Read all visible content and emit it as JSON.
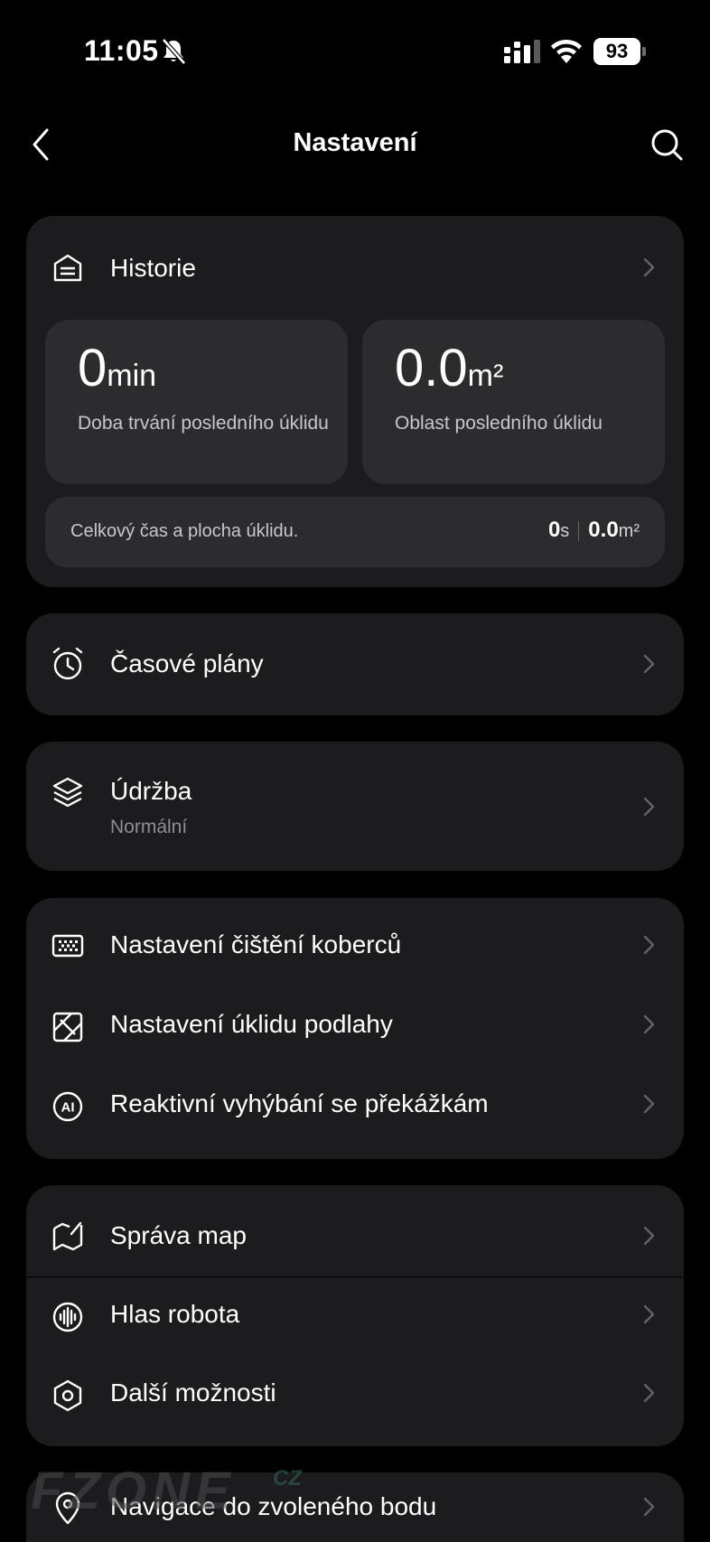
{
  "status": {
    "time": "11:05",
    "battery": "93"
  },
  "header": {
    "title": "Nastavení"
  },
  "history": {
    "label": "Historie",
    "duration_value": "0",
    "duration_unit": "min",
    "duration_label": "Doba trvání posledního úklidu",
    "area_value": "0.0",
    "area_unit": "m²",
    "area_label": "Oblast posledního úklidu",
    "total_label": "Celkový čas a plocha úklidu.",
    "total_time_value": "0",
    "total_time_unit": "s",
    "total_area_value": "0.0",
    "total_area_unit": "m²"
  },
  "schedules": {
    "label": "Časové plány"
  },
  "maintenance": {
    "label": "Údržba",
    "status": "Normální"
  },
  "cleaning_settings": {
    "items": [
      {
        "label": "Nastavení čištění koberců",
        "icon": "carpet-icon"
      },
      {
        "label": "Nastavení úklidu podlahy",
        "icon": "floor-icon"
      },
      {
        "label": "Reaktivní vyhýbání se překážkám",
        "icon": "ai-icon"
      }
    ]
  },
  "other_settings": {
    "items": [
      {
        "label": "Správa map",
        "icon": "map-icon"
      },
      {
        "label": "Hlas robota",
        "icon": "voice-icon"
      },
      {
        "label": "Další možnosti",
        "icon": "hexagon-icon"
      }
    ]
  },
  "navigation": {
    "label": "Navigace do zvoleného bodu"
  },
  "watermark": {
    "text": "FZONE",
    "suffix": "CZ"
  }
}
